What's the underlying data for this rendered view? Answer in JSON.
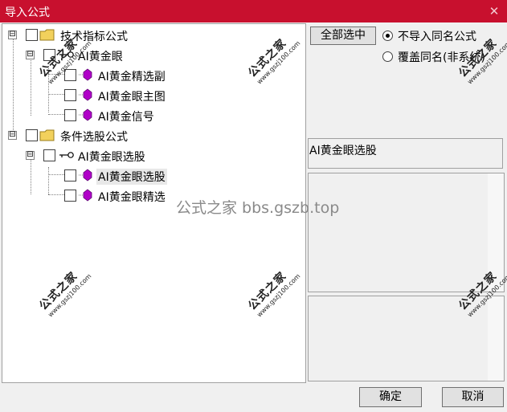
{
  "window": {
    "title": "导入公式",
    "close_glyph": "✕"
  },
  "tree": {
    "nodes": [
      {
        "label": "技术指标公式",
        "level": 0,
        "type": "folder",
        "expander": "⊟",
        "checked": false
      },
      {
        "label": "AI黄金眼",
        "level": 1,
        "type": "key",
        "expander": "⊟",
        "checked": false
      },
      {
        "label": "AI黄金精选副",
        "level": 2,
        "type": "formula",
        "checked": false
      },
      {
        "label": "AI黄金眼主图",
        "level": 2,
        "type": "formula",
        "checked": false
      },
      {
        "label": "AI黄金信号",
        "level": 2,
        "type": "formula",
        "checked": false
      },
      {
        "label": "条件选股公式",
        "level": 0,
        "type": "folder",
        "expander": "⊟",
        "checked": false
      },
      {
        "label": "AI黄金眼选股",
        "level": 1,
        "type": "key",
        "expander": "⊟",
        "checked": false
      },
      {
        "label": "AI黄金眼选股",
        "level": 2,
        "type": "formula",
        "checked": false,
        "selected": true
      },
      {
        "label": "AI黄金眼精选",
        "level": 2,
        "type": "formula",
        "checked": false
      }
    ]
  },
  "right": {
    "select_all_label": "全部选中",
    "radio_options": [
      {
        "label": "不导入同名公式",
        "checked": true
      },
      {
        "label": "覆盖同名(非系统)",
        "checked": false
      }
    ],
    "info_text": "AI黄金眼选股"
  },
  "footer": {
    "ok_label": "确定",
    "cancel_label": "取消"
  },
  "watermarks": {
    "overlay_text": "公式之家 bbs.gszb.top",
    "stamp_big": "公式之家",
    "stamp_small": "www.gszj100.com"
  },
  "colors": {
    "titlebar": "#c8102e",
    "folder": "#f2d15c",
    "formula": "#b000c8"
  }
}
